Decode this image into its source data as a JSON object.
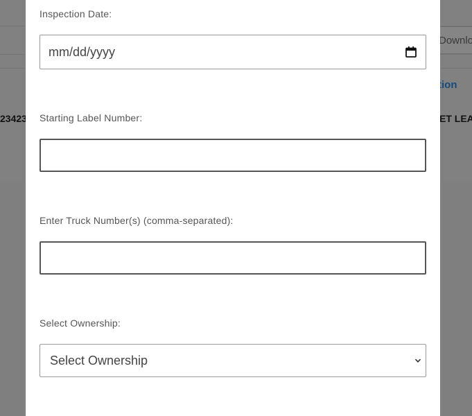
{
  "background": {
    "download_label": "Downlo",
    "action_label": "tion",
    "row_left_text": "23423",
    "row_right_text": "ET LEA"
  },
  "modal": {
    "inspection_date": {
      "label": "Inspection Date:",
      "placeholder": "mm/dd/yyyy"
    },
    "starting_label_number": {
      "label": "Starting Label Number:",
      "value": ""
    },
    "truck_numbers": {
      "label": "Enter Truck Number(s) (comma-separated):",
      "value": ""
    },
    "ownership": {
      "label": "Select Ownership:",
      "selected": "Select Ownership"
    }
  }
}
